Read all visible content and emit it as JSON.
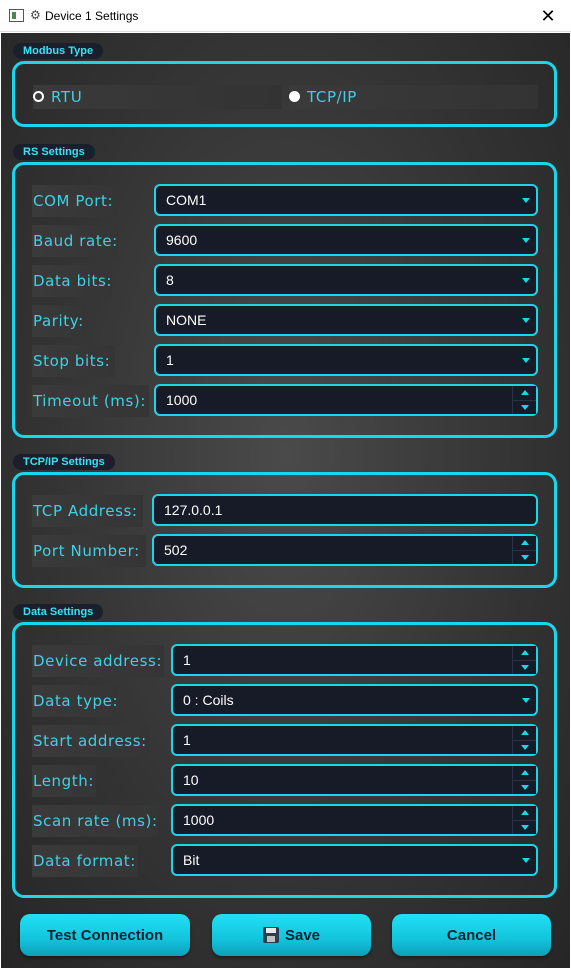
{
  "window": {
    "title": "Device 1 Settings",
    "close_glyph": "✕",
    "title_icon_glyph": "⚙"
  },
  "modbus_type": {
    "label": "Modbus Type",
    "options": [
      {
        "label": "RTU",
        "checked": false
      },
      {
        "label": "TCP/IP",
        "checked": true
      }
    ]
  },
  "rs_settings": {
    "label": "RS Settings",
    "com_port": {
      "label": "COM Port:",
      "value": "COM1"
    },
    "baud_rate": {
      "label": "Baud rate:",
      "value": "9600"
    },
    "data_bits": {
      "label": "Data bits:",
      "value": "8"
    },
    "parity": {
      "label": "Parity:",
      "value": "NONE"
    },
    "stop_bits": {
      "label": "Stop bits:",
      "value": "1"
    },
    "timeout": {
      "label": "Timeout (ms):",
      "value": "1000"
    }
  },
  "tcp_settings": {
    "label": "TCP/IP Settings",
    "tcp_address": {
      "label": "TCP Address:",
      "value": "127.0.0.1"
    },
    "port_number": {
      "label": "Port Number:",
      "value": "502"
    }
  },
  "data_settings": {
    "label": "Data Settings",
    "device_address": {
      "label": "Device address:",
      "value": "1"
    },
    "data_type": {
      "label": "Data type:",
      "value": "0 : Coils"
    },
    "start_address": {
      "label": "Start address:",
      "value": "1"
    },
    "length": {
      "label": "Length:",
      "value": "10"
    },
    "scan_rate": {
      "label": "Scan rate (ms):",
      "value": "1000"
    },
    "data_format": {
      "label": "Data format:",
      "value": "Bit"
    }
  },
  "buttons": {
    "test_connection": "Test Connection",
    "save": "Save",
    "cancel": "Cancel"
  },
  "colors": {
    "accent": "#1ad6ec",
    "label_text": "#3fd0e6",
    "control_bg": "#161b27",
    "background": "#333333"
  }
}
